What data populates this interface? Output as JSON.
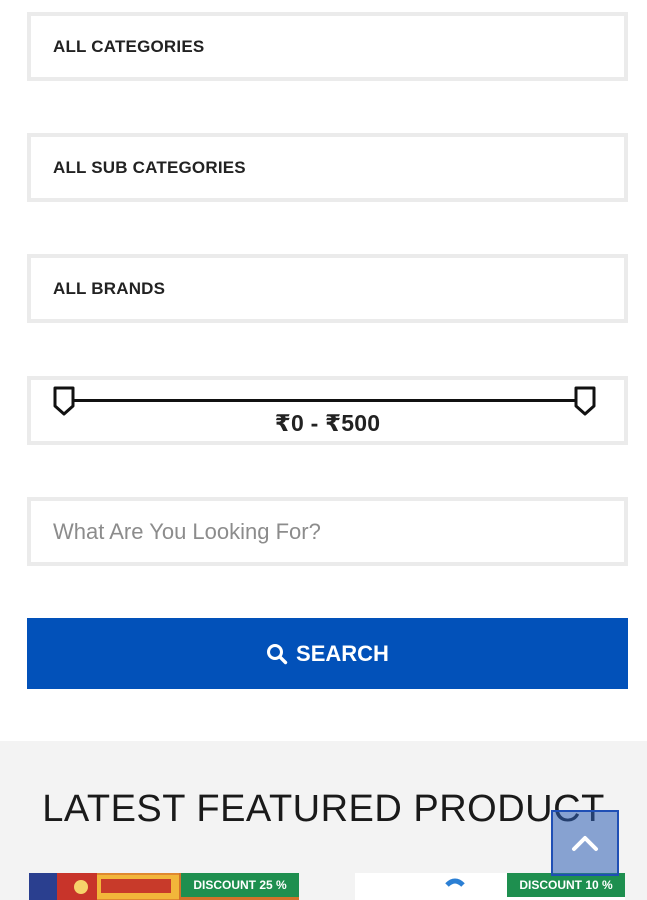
{
  "filters": {
    "category_label": "ALL CATEGORIES",
    "sub_category_label": "ALL SUB CATEGORIES",
    "brand_label": "ALL BRANDS"
  },
  "price_range": {
    "text": "₹0 - ₹500",
    "min": 0,
    "max": 500
  },
  "search": {
    "placeholder": "What Are You Looking For?",
    "value": "",
    "button_label": "SEARCH",
    "button_icon": "search-icon"
  },
  "featured": {
    "title": "LATEST FEATURED PRODUCT",
    "products": [
      {
        "badge": "DISCOUNT 25 %"
      },
      {
        "badge": "DISCOUNT 10 %"
      }
    ]
  },
  "scroll_top_icon": "chevron-up-icon",
  "colors": {
    "primary_button": "#0251b9",
    "field_border": "#ebebeb",
    "discount_badge": "#1e8f4f",
    "featured_bg": "#f3f3f3",
    "scroll_top": "#2d5fb4"
  }
}
